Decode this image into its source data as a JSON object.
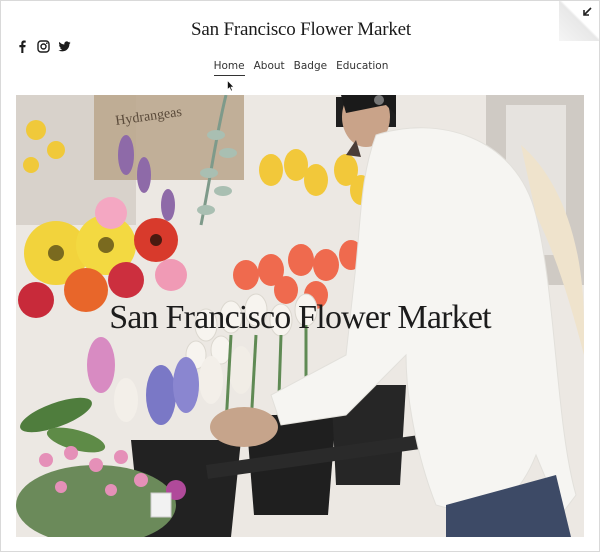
{
  "header": {
    "title": "San Francisco Flower Market",
    "social_icons": [
      "facebook-icon",
      "instagram-icon",
      "twitter-icon"
    ]
  },
  "nav": {
    "items": [
      {
        "label": "Home",
        "active": true
      },
      {
        "label": "About",
        "active": false
      },
      {
        "label": "Badge",
        "active": false
      },
      {
        "label": "Education",
        "active": false
      }
    ]
  },
  "hero": {
    "title": "San Francisco Flower Market",
    "sign_text": "Hydrangeas"
  },
  "colors": {
    "text": "#1b1b1b",
    "nav_text": "#333333",
    "background": "#ffffff"
  }
}
